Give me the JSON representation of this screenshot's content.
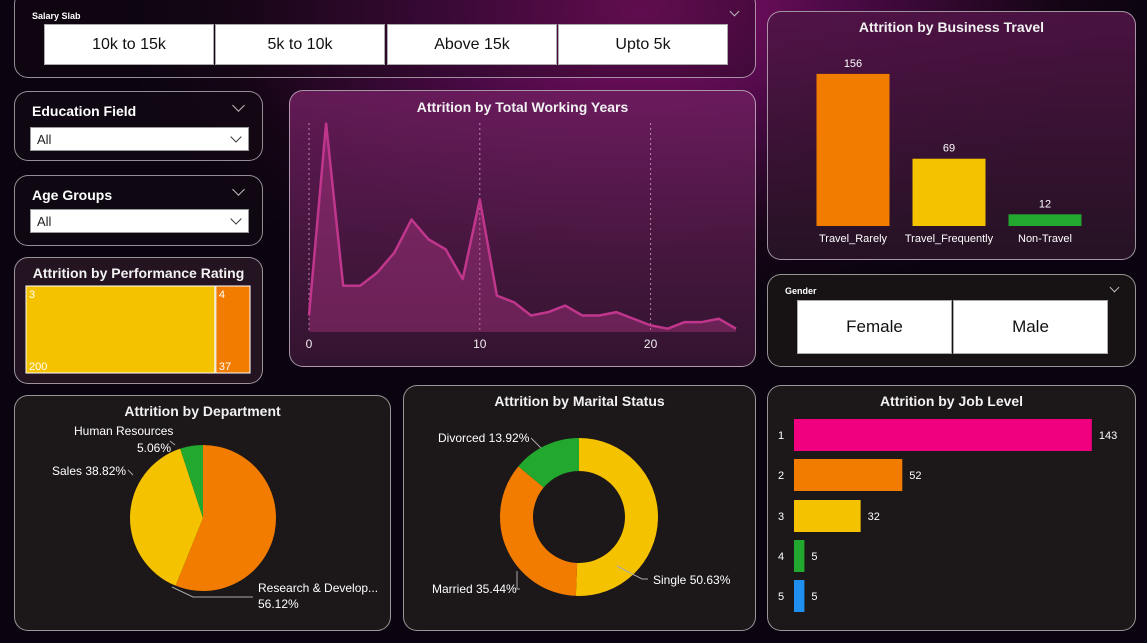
{
  "salary_slab": {
    "label": "Salary Slab",
    "options": [
      "10k to 15k",
      "5k to 10k",
      "Above 15k",
      "Upto 5k"
    ]
  },
  "education_field": {
    "label": "Education Field",
    "value": "All"
  },
  "age_groups": {
    "label": "Age Groups",
    "value": "All"
  },
  "gender": {
    "label": "Gender",
    "options": [
      "Female",
      "Male"
    ]
  },
  "colors": {
    "orange": "#f27c00",
    "yellow": "#f5c200",
    "green": "#22a82e",
    "pink": "#f0007f",
    "blue": "#1f8fef",
    "magenta_line": "#c0368c"
  },
  "chart_data": [
    {
      "id": "working_years",
      "type": "area",
      "title": "Attrition by Total Working Years",
      "x": [
        0,
        1,
        2,
        3,
        4,
        5,
        6,
        7,
        8,
        9,
        10,
        11,
        12,
        13,
        14,
        15,
        16,
        17,
        18,
        19,
        20,
        21,
        22,
        23,
        24,
        25
      ],
      "values": [
        5,
        63,
        14,
        14,
        18,
        24,
        34,
        28,
        25,
        16,
        40,
        11,
        9,
        5,
        6,
        8,
        5,
        5,
        6,
        4,
        2,
        1,
        3,
        3,
        4,
        1
      ],
      "xticks": [
        "0",
        "10",
        "20"
      ],
      "xlim": [
        0,
        25
      ],
      "ylim": [
        0,
        65
      ],
      "grid": "dotted vertical at x ticks"
    },
    {
      "id": "business_travel",
      "type": "bar",
      "title": "Attrition by Business Travel",
      "categories": [
        "Travel_Rarely",
        "Travel_Frequently",
        "Non-Travel"
      ],
      "values": [
        156,
        69,
        12
      ],
      "labels": [
        "156",
        "69",
        "12"
      ],
      "colors": [
        "#f27c00",
        "#f5c200",
        "#22a82e"
      ],
      "ylim": [
        0,
        160
      ]
    },
    {
      "id": "performance_rating",
      "type": "treemap",
      "title": "Attrition by Performance Rating",
      "categories": [
        "3",
        "4"
      ],
      "values": [
        200,
        37
      ],
      "value_labels": [
        "200",
        "37"
      ],
      "colors": [
        "#f5c200",
        "#f27c00"
      ]
    },
    {
      "id": "department",
      "type": "pie",
      "title": "Attrition by Department",
      "categories": [
        "Research & Develop...",
        "Sales",
        "Human Resources"
      ],
      "values": [
        56.12,
        38.82,
        5.06
      ],
      "labels": [
        "56.12%",
        "Sales 38.82%",
        "5.06%"
      ],
      "colors": [
        "#f27c00",
        "#f5c200",
        "#22a82e"
      ]
    },
    {
      "id": "marital_status",
      "type": "pie",
      "donut": true,
      "title": "Attrition by Marital Status",
      "categories": [
        "Single",
        "Married",
        "Divorced"
      ],
      "values": [
        50.63,
        35.44,
        13.92
      ],
      "labels": [
        "Single 50.63%",
        "Married 35.44%",
        "Divorced 13.92%"
      ],
      "colors": [
        "#f5c200",
        "#f27c00",
        "#22a82e"
      ]
    },
    {
      "id": "job_level",
      "type": "bar",
      "orientation": "horizontal",
      "title": "Attrition by Job Level",
      "categories": [
        "1",
        "2",
        "3",
        "4",
        "5"
      ],
      "values": [
        143,
        52,
        32,
        5,
        5
      ],
      "labels": [
        "143",
        "52",
        "32",
        "5",
        "5"
      ],
      "colors": [
        "#f0007f",
        "#f27c00",
        "#f5c200",
        "#22a82e",
        "#1f8fef"
      ],
      "xlim": [
        0,
        145
      ]
    }
  ]
}
